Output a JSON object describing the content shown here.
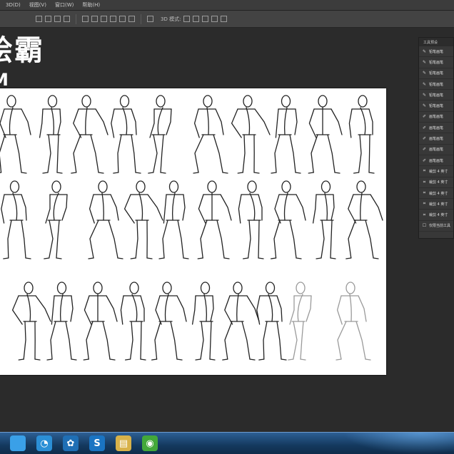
{
  "menubar": {
    "items": [
      "3D(D)",
      "视图(V)",
      "窗口(W)",
      "帮助(H)"
    ]
  },
  "options": {
    "mode_label": "3D 模式:"
  },
  "overlay": {
    "title": "绘霸",
    "subtitle": "M"
  },
  "panel": {
    "title": "工具预设",
    "items": [
      {
        "icon": "pencil-icon",
        "label": "铅笔画笔"
      },
      {
        "icon": "pencil-icon",
        "label": "铅笔画笔"
      },
      {
        "icon": "pencil-icon",
        "label": "铅笔画笔"
      },
      {
        "icon": "pencil-icon",
        "label": "铅笔画笔"
      },
      {
        "icon": "pencil-icon",
        "label": "铅笔画笔"
      },
      {
        "icon": "pencil-icon",
        "label": "铅笔画笔"
      },
      {
        "icon": "brush-icon",
        "label": "画笔画笔"
      },
      {
        "icon": "brush-icon",
        "label": "画笔画笔"
      },
      {
        "icon": "brush-icon",
        "label": "画笔画笔"
      },
      {
        "icon": "brush-icon",
        "label": "画笔画笔"
      },
      {
        "icon": "brush-icon",
        "label": "画笔画笔"
      },
      {
        "icon": "crop-icon",
        "label": "裁剪 4 英寸"
      },
      {
        "icon": "crop-icon",
        "label": "裁剪 4 英寸"
      },
      {
        "icon": "crop-icon",
        "label": "裁剪 4 英寸"
      },
      {
        "icon": "crop-icon",
        "label": "裁剪 4 英寸"
      },
      {
        "icon": "crop-icon",
        "label": "裁剪 4 英寸"
      }
    ],
    "footer": "仅限当前工具"
  },
  "taskbar": {
    "apps": [
      {
        "name": "start-button",
        "glyph": "",
        "color": "#3aa0e8"
      },
      {
        "name": "browser-icon",
        "glyph": "◔",
        "color": "#2b8fd6"
      },
      {
        "name": "app-cluster-icon",
        "glyph": "✿",
        "color": "#1f6fb5"
      },
      {
        "name": "sogou-icon",
        "glyph": "S",
        "color": "#1a74c2"
      },
      {
        "name": "folder-icon",
        "glyph": "▤",
        "color": "#d8b24a"
      },
      {
        "name": "wechat-icon",
        "glyph": "◉",
        "color": "#43a83a"
      }
    ]
  },
  "colors": {
    "app_bg": "#2b2b2b",
    "canvas_bg": "#ffffff",
    "panel_bg": "#383838"
  }
}
